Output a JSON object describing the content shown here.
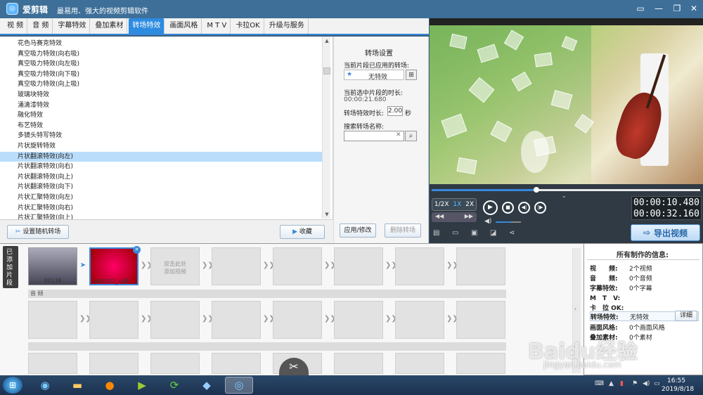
{
  "app": {
    "name": "爱剪辑",
    "slogan": "最易用、强大的视频剪辑软件"
  },
  "window_buttons": [
    "▭",
    "—",
    "❐",
    "✕"
  ],
  "tabs": [
    {
      "label": "视 频"
    },
    {
      "label": "音 频"
    },
    {
      "label": "字幕特效"
    },
    {
      "label": "叠加素材"
    },
    {
      "label": "转场特效",
      "active": true
    },
    {
      "label": "画面风格"
    },
    {
      "label": "M T V"
    },
    {
      "label": "卡拉OK"
    },
    {
      "label": "升级与服务"
    }
  ],
  "effects": [
    "花色马赛克特效",
    "真空吸力特效(向右吸)",
    "真空吸力特效(向左吸)",
    "真空吸力特效(向下吸)",
    "真空吸力特效(向上吸)",
    "玻璃块特效",
    "涌滴漆特效",
    "融化特效",
    "布艺特效",
    "多镜头特写特效",
    "片状旋转特效",
    "片状翻滚特效(向左)",
    "片状翻滚特效(向右)",
    "片状翻滚特效(向上)",
    "片状翻滚特效(向下)",
    "片状汇聚特效(向左)",
    "片状汇聚特效(向右)",
    "片状汇聚特效(向上)"
  ],
  "selected_effect_index": 11,
  "list_buttons": {
    "random": "设置随机转场",
    "favorite": "收藏"
  },
  "settings": {
    "title": "转场设置",
    "applied_label": "当前片段已应用的转场:",
    "applied_value": "无特效",
    "duration_label": "当前选中片段的时长:",
    "duration_value": "00:00:21.680",
    "effect_duration_label": "转场特效时长:",
    "effect_duration_value": "2.00",
    "effect_duration_unit": "秒",
    "search_label": "搜索转场名称:",
    "search_value": "",
    "apply_button": "应用/修改",
    "delete_button": "删除转场"
  },
  "player": {
    "speeds": [
      "1/2X",
      "1X",
      "2X"
    ],
    "active_speed": "1X",
    "current_time": "00:00:10.480",
    "total_time": "00:00:32.160",
    "export_button": "导出视频",
    "progress": 0.39,
    "volume": 0.6
  },
  "timeline": {
    "side_label": "已添加片段",
    "clips": [
      {
        "name": "00138"
      },
      {
        "name": "440332_vj师..."
      }
    ],
    "placeholder": "双击此处添加视频",
    "audio_label": "音 频"
  },
  "info": {
    "title": "所有制作的信息:",
    "rows": [
      {
        "key": "视　　频:",
        "value": "2个视频"
      },
      {
        "key": "音　　频:",
        "value": "0个音频"
      },
      {
        "key": "字幕特效:",
        "value": "0个字幕"
      },
      {
        "key": "M　T　V:",
        "value": ""
      },
      {
        "key": "卡　拉 OK:",
        "value": ""
      },
      {
        "key": "转场特效:",
        "value": "无特效"
      },
      {
        "key": "画面风格:",
        "value": "0个画面风格"
      },
      {
        "key": "叠加素材:",
        "value": "0个素材"
      }
    ],
    "detail_button": "详细"
  },
  "taskbar": {
    "time": "16:55",
    "date": "2019/8/18"
  },
  "watermark": {
    "text": "Baidu经验",
    "url": "jingyan.baidu.com"
  }
}
